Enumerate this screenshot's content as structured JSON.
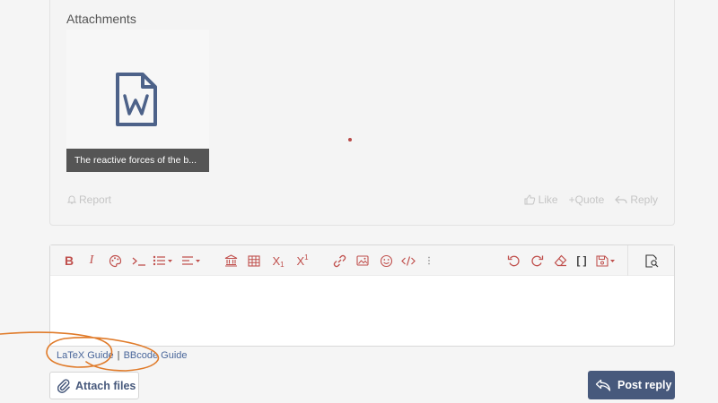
{
  "attachments": {
    "title": "Attachments",
    "items": [
      {
        "filename": "The reactive forces of the b...",
        "icon": "word-document-icon"
      }
    ]
  },
  "post_actions": {
    "report": "Report",
    "like": "Like",
    "quote": "+Quote",
    "reply": "Reply"
  },
  "editor": {
    "toolbar": [
      "bold-icon",
      "italic-icon",
      "text-color-icon",
      "code-inline-icon",
      "list-icon",
      "align-icon",
      "bank-icon",
      "table-icon",
      "subscript-icon",
      "superscript-icon",
      "link-icon",
      "image-icon",
      "smiley-icon",
      "code-icon",
      "more-icon",
      "undo-icon",
      "redo-icon",
      "eraser-icon",
      "brackets-icon",
      "save-draft-icon",
      "preview-icon"
    ],
    "value": "",
    "labels": {
      "bold": "B",
      "italic": "I",
      "subscript": "X",
      "subscript_sub": "1",
      "superscript": "X",
      "superscript_sup": "1",
      "brackets": "[ ]"
    }
  },
  "guides": {
    "latex": "LaTeX Guide",
    "separator": "|",
    "bbcode": "BBcode Guide"
  },
  "buttons": {
    "attach": "Attach files",
    "post": "Post reply"
  },
  "colors": {
    "accent": "#47597c",
    "toolbar_icon": "#c0504d",
    "link": "#49669a",
    "annotation": "#e07b2a"
  }
}
